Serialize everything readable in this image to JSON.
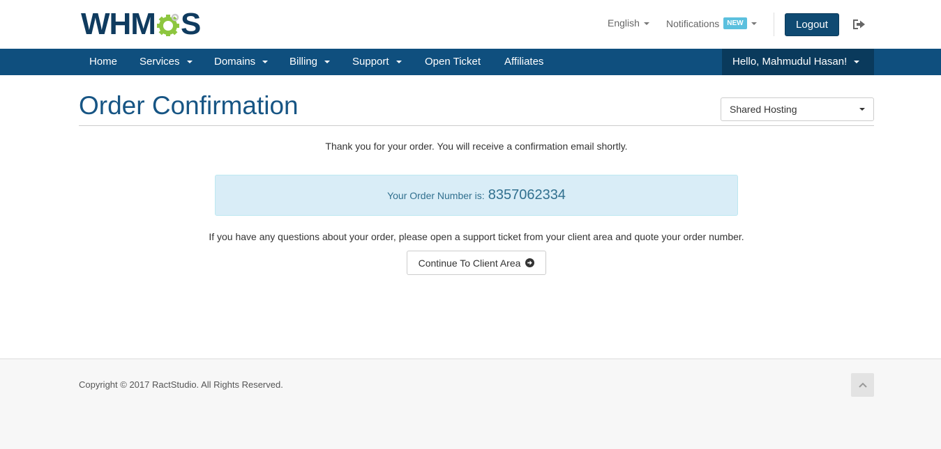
{
  "brand": {
    "logo_text_left": "WHM",
    "logo_text_right": "S"
  },
  "header": {
    "language_label": "English",
    "notifications_label": "Notifications",
    "notifications_badge": "NEW",
    "logout_label": "Logout"
  },
  "nav": {
    "items": [
      {
        "label": "Home"
      },
      {
        "label": "Services"
      },
      {
        "label": "Domains"
      },
      {
        "label": "Billing"
      },
      {
        "label": "Support"
      },
      {
        "label": "Open Ticket"
      },
      {
        "label": "Affiliates"
      }
    ],
    "user_label": "Hello, Mahmudul Hasan!"
  },
  "main": {
    "title": "Order Confirmation",
    "category_select": "Shared Hosting",
    "thanks_text": "Thank you for your order. You will receive a confirmation email shortly.",
    "order_label": "Your Order Number is:",
    "order_number": "8357062334",
    "questions_text": "If you have any questions about your order, please open a support ticket from your client area and quote your order number.",
    "continue_label": "Continue To Client Area"
  },
  "footer": {
    "copyright": "Copyright © 2017 RactStudio. All Rights Reserved."
  },
  "colors": {
    "nav_bg": "#0f4f7e",
    "nav_user_bg": "#0a3a5c",
    "title": "#175584",
    "alert_bg": "#d9edf7",
    "alert_text": "#31708f",
    "gear_green": "#8dc63f"
  }
}
